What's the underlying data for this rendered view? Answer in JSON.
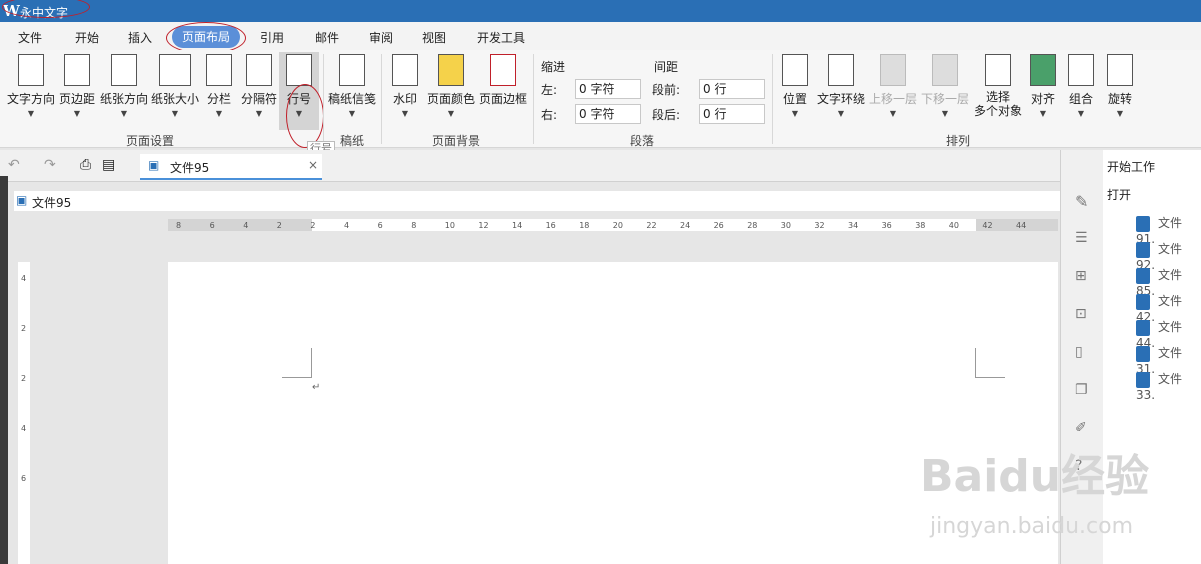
{
  "title": {
    "app": "永中文字"
  },
  "menu": {
    "items": [
      "文件",
      "开始",
      "插入",
      "页面布局",
      "引用",
      "邮件",
      "审阅",
      "视图",
      "开发工具"
    ]
  },
  "ribbon": {
    "page_setup": [
      "文字方向",
      "页边距",
      "纸张方向",
      "纸张大小",
      "分栏",
      "分隔符",
      "行号"
    ],
    "page_setup_group": "页面设置",
    "manuscript": "稿纸信笺",
    "manuscript_group": "稿纸",
    "bg": [
      "水印",
      "页面颜色",
      "页面边框"
    ],
    "bg_group": "页面背景",
    "indent_title": "缩进",
    "spacing_title": "间距",
    "left_label": "左:",
    "right_label": "右:",
    "before_label": "段前:",
    "after_label": "段后:",
    "left_value": "0 字符",
    "right_value": "0 字符",
    "before_value": "0 行",
    "after_value": "0 行",
    "para_group": "段落",
    "arrange": [
      "位置",
      "文字环绕",
      "上移一层",
      "下移一层",
      "选择\n多个对象",
      "对齐",
      "组合",
      "旋转"
    ],
    "arrange_group": "排列"
  },
  "tooltip": "行号",
  "doc": {
    "tab": "文件95",
    "path": "文件95"
  },
  "ruler": [
    "8",
    "6",
    "4",
    "2",
    "2",
    "4",
    "6",
    "8",
    "10",
    "12",
    "14",
    "16",
    "18",
    "20",
    "22",
    "24",
    "26",
    "28",
    "30",
    "32",
    "34",
    "36",
    "38",
    "40",
    "42",
    "44"
  ],
  "vruler": [
    "4",
    "2",
    "2",
    "4",
    "6"
  ],
  "rightpanel": {
    "start": "开始工作",
    "open": "打开",
    "files": [
      "文件91.",
      "文件92.",
      "文件85.",
      "文件42.",
      "文件44.",
      "文件31.",
      "文件33."
    ]
  },
  "watermark": {
    "main": "Baidu经验",
    "url": "jingyan.baidu.com"
  }
}
